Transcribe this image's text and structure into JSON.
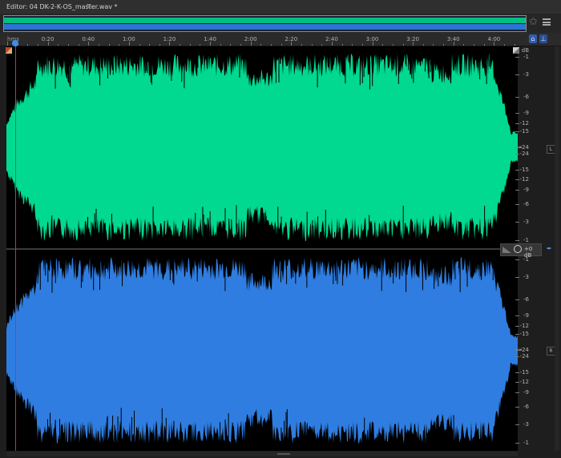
{
  "editor": {
    "tab_title": "Editor: 04 DK-2-K-OS_master.wav *",
    "tab_menu_icon": "hamburger-icon"
  },
  "overview": {
    "favorite_icon": "star-icon",
    "panel_menu_icon": "panel-menu-icon"
  },
  "ruler": {
    "unit": "hms",
    "labels": [
      "0:20",
      "0:40",
      "1:00",
      "1:20",
      "1:40",
      "2:00",
      "2:20",
      "2:40",
      "3:00",
      "3:20",
      "3:40",
      "4:00"
    ],
    "zoom_to_fit_icon": "zoom-fit-icon",
    "pin_icon": "pin-icon"
  },
  "amplitude_scale": {
    "unit": "dB",
    "top_channel": [
      "-1",
      "-3",
      "-6",
      "-9",
      "-12",
      "-15",
      "-24",
      "-24",
      "-15",
      "-12",
      "-9",
      "-6",
      "-3",
      "-1"
    ],
    "bottom_channel": [
      "-1",
      "-3",
      "-6",
      "-9",
      "-12",
      "-15",
      "-24",
      "-24",
      "-15",
      "-12",
      "-9",
      "-6",
      "-3",
      "-1"
    ],
    "infinity_marker": "-∞"
  },
  "channels": {
    "left": {
      "label": "L",
      "color": "#00d98f"
    },
    "right": {
      "label": "R",
      "color": "#2f7de0"
    }
  },
  "gain_control": {
    "value": "+0 dB"
  },
  "colors": {
    "playhead": "#d43030",
    "background": "#000000"
  }
}
